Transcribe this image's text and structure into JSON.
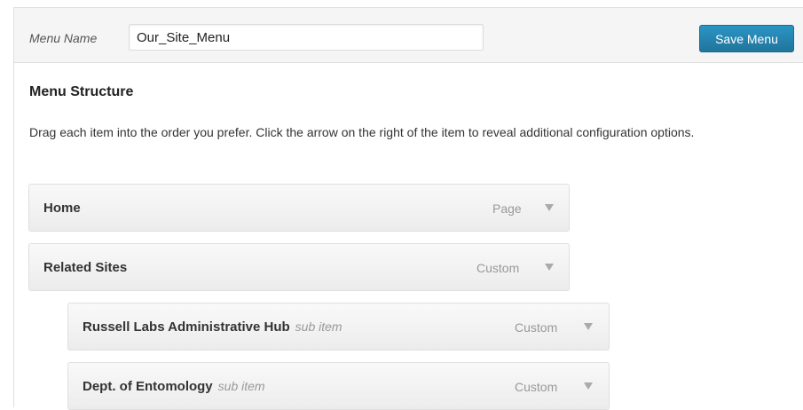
{
  "header": {
    "menu_name_label": "Menu Name",
    "menu_name_value": "Our_Site_Menu",
    "save_label": "Save Menu"
  },
  "structure": {
    "title": "Menu Structure",
    "instructions": "Drag each item into the order you prefer. Click the arrow on the right of the item to reveal additional configuration options."
  },
  "items": [
    {
      "title": "Home",
      "sub": "",
      "type": "Page"
    },
    {
      "title": "Related Sites",
      "sub": "",
      "type": "Custom"
    },
    {
      "title": "Russell Labs Administrative Hub",
      "sub": "sub item",
      "type": "Custom"
    },
    {
      "title": "Dept. of Entomology",
      "sub": "sub item",
      "type": "Custom"
    }
  ],
  "colors": {
    "accent": "#21759b",
    "header_bg": "#f5f5f5",
    "item_bg": "#f1f1f1"
  },
  "icons": {
    "item_toggle": "triangle-down-icon"
  }
}
